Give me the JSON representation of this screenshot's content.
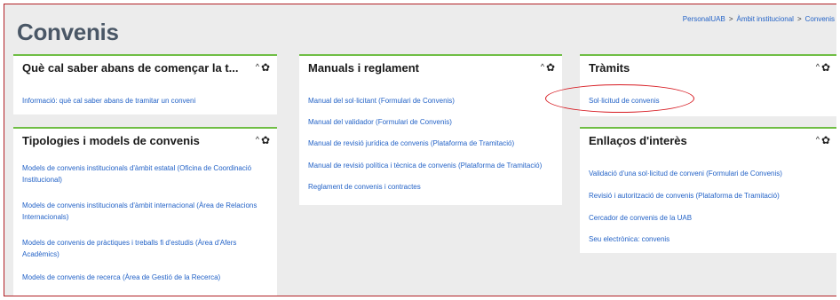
{
  "page": {
    "title": "Convenis"
  },
  "breadcrumb": {
    "items": [
      "PersonalUAB",
      "Àmbit institucional",
      "Convenis"
    ],
    "separator": ">"
  },
  "icons": {
    "collapse": "caret-up-icon",
    "settings": "gear-icon"
  },
  "colors": {
    "accent": "#6fbe44",
    "link": "#2463c7",
    "title": "#4a5766",
    "highlight": "#d71920"
  },
  "cards": {
    "before_start": {
      "title": "Què cal saber abans de començar la t...",
      "links": [
        "Informació: què cal saber abans de tramitar un conveni"
      ]
    },
    "typologies": {
      "title": "Tipologies i models de convenis",
      "links": [
        "Models de convenis institucionals d'àmbit estatal (Oficina de Coordinació Institucional)",
        "Models de convenis institucionals d'àmbit internacional (Àrea de Relacions Internacionals)",
        "Models de convenis de pràctiques i treballs fi d'estudis (Àrea d'Afers Acadèmics)",
        "Models de convenis de recerca (Àrea de Gestió de la Recerca)"
      ]
    },
    "manuals": {
      "title": "Manuals i reglament",
      "links": [
        "Manual del sol·licitant (Formulari de Convenis)",
        "Manual del validador (Formulari de Convenis)",
        "Manual de revisió jurídica de convenis (Plataforma de Tramitació)",
        "Manual de revisió política i tècnica de convenis (Plataforma de Tramitació)",
        "Reglament de convenis i contractes"
      ]
    },
    "procedures": {
      "title": "Tràmits",
      "links": [
        "Sol·licitud de convenis"
      ]
    },
    "links_of_interest": {
      "title": "Enllaços d'interès",
      "links": [
        "Validació d'una sol·licitud de conveni (Formulari de Convenis)",
        "Revisió i autorització de convenis (Plataforma de Tramitació)",
        "Cercador de convenis de la UAB",
        "Seu electrònica: convenis"
      ]
    }
  },
  "controls": {
    "collapse_glyph": "^",
    "settings_glyph": "✿"
  }
}
